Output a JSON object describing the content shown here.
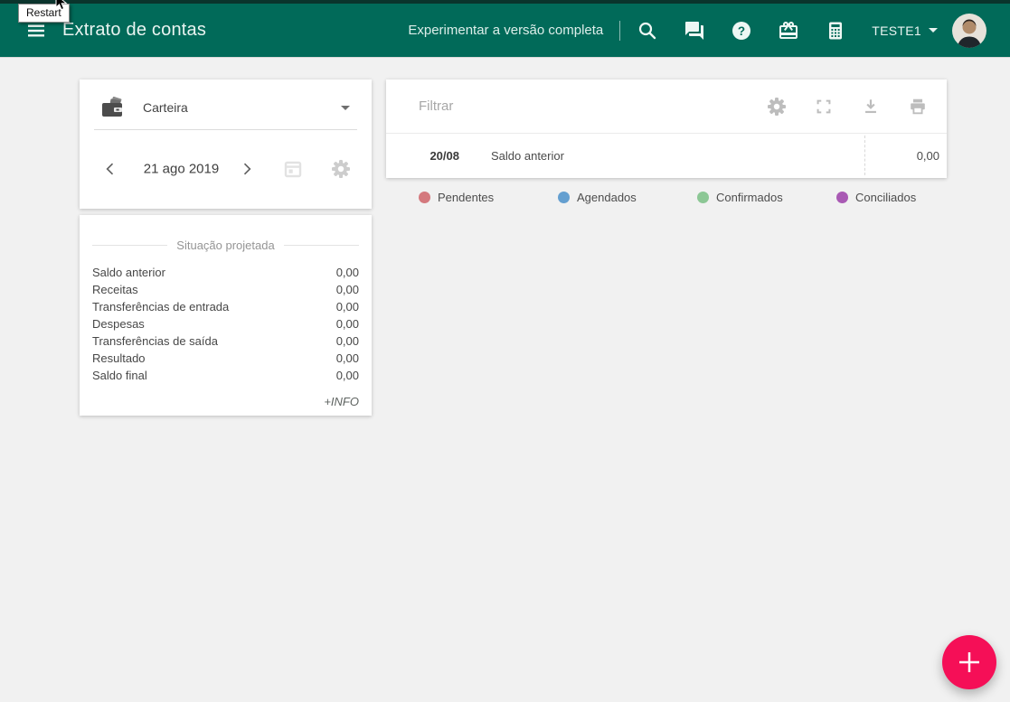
{
  "tooltip": {
    "text": "Restart"
  },
  "appbar": {
    "background": "#016a59",
    "title": "Extrato de contas",
    "trial_link": "Experimentar a versão completa",
    "account_name": "TESTE1",
    "icons": [
      "menu-icon",
      "search-icon",
      "chat-icon",
      "help-icon",
      "gift-icon",
      "calculator-icon",
      "avatar"
    ]
  },
  "account_card": {
    "account_label": "Carteira",
    "date": "21 ago 2019",
    "icons": [
      "wallet-icon",
      "chevron-left-icon",
      "chevron-right-icon",
      "calendar-icon",
      "gear-icon"
    ]
  },
  "projection_card": {
    "title": "Situação projetada",
    "rows": [
      {
        "label": "Saldo anterior",
        "value": "0,00"
      },
      {
        "label": "Receitas",
        "value": "0,00"
      },
      {
        "label": "Transferências de entrada",
        "value": "0,00"
      },
      {
        "label": "Despesas",
        "value": "0,00"
      },
      {
        "label": "Transferências de saída",
        "value": "0,00"
      },
      {
        "label": "Resultado",
        "value": "0,00"
      },
      {
        "label": "Saldo final",
        "value": "0,00"
      }
    ],
    "info_link": "+INFO"
  },
  "statement_card": {
    "filter_placeholder": "Filtrar",
    "toolbar_icons": [
      "gear-icon",
      "fullscreen-icon",
      "download-icon",
      "print-icon"
    ],
    "rows": [
      {
        "date": "20/08",
        "description": "Saldo anterior",
        "amount": "0,00"
      }
    ]
  },
  "legend": {
    "items": [
      {
        "label": "Pendentes",
        "color": "#d4797e"
      },
      {
        "label": "Agendados",
        "color": "#649fd0"
      },
      {
        "label": "Confirmados",
        "color": "#8cc795"
      },
      {
        "label": "Conciliados",
        "color": "#a95ab4"
      }
    ]
  },
  "fab": {
    "color": "#f50f57",
    "icon": "plus-icon"
  }
}
